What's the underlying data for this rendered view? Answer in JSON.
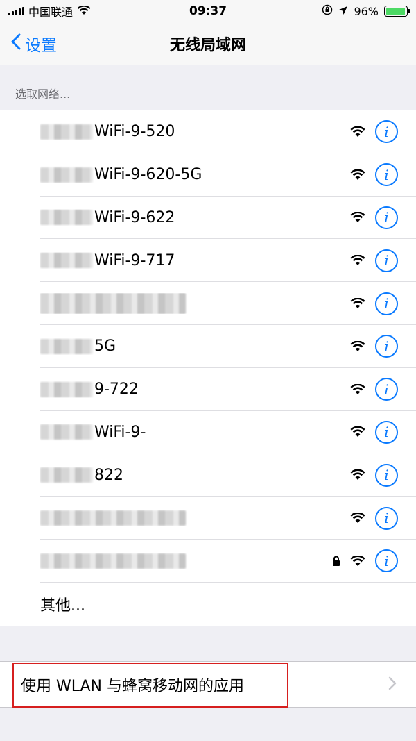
{
  "status_bar": {
    "carrier": "中国联通",
    "time": "09:37",
    "battery": "96%",
    "battery_level": 0.96
  },
  "nav": {
    "back_label": "设置",
    "title": "无线局域网"
  },
  "section_header": "选取网络...",
  "networks": [
    {
      "name": "WiFi-9-520",
      "lock": false,
      "signal": 3
    },
    {
      "name": "WiFi-9-620-5G",
      "lock": false,
      "signal": 2
    },
    {
      "name": "WiFi-9-622",
      "lock": false,
      "signal": 2
    },
    {
      "name": "WiFi-9-717",
      "lock": false,
      "signal": 3
    },
    {
      "name": "",
      "lock": false,
      "signal": 3
    },
    {
      "name": "5G",
      "lock": false,
      "signal": 2
    },
    {
      "name": "9-722",
      "lock": false,
      "signal": 3
    },
    {
      "name": "WiFi-9-",
      "lock": false,
      "signal": 3
    },
    {
      "name": "822",
      "lock": false,
      "signal": 2
    },
    {
      "name": "",
      "lock": false,
      "signal": 2
    },
    {
      "name": "",
      "lock": true,
      "signal": 2
    }
  ],
  "other_label": "其他...",
  "apps_row_label": "使用 WLAN 与蜂窝移动网的应用",
  "colors": {
    "accent": "#0a7aff",
    "highlight": "#d61f1f",
    "battery": "#4cd964"
  }
}
